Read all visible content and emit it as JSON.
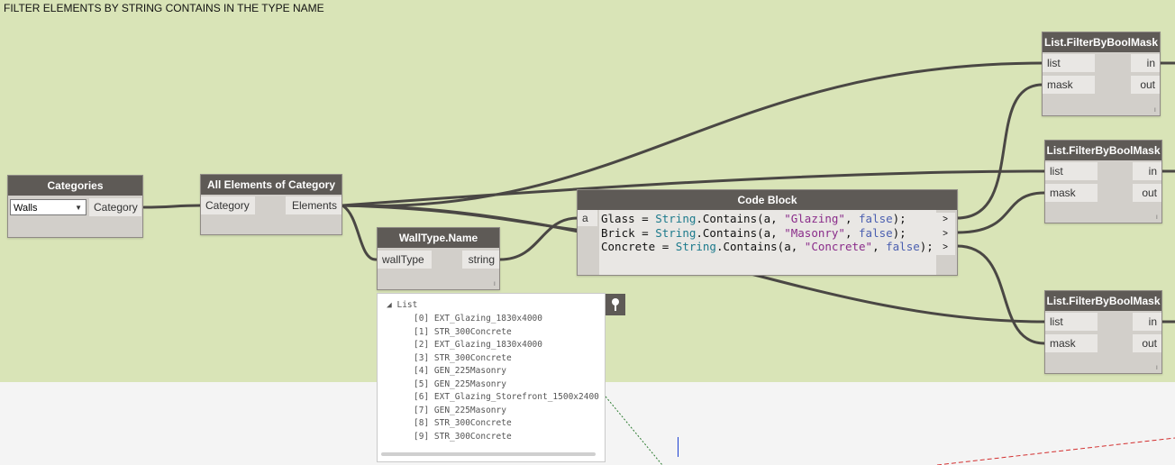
{
  "group": {
    "title": "FILTER ELEMENTS BY STRING CONTAINS IN THE TYPE NAME"
  },
  "nodes": {
    "categories": {
      "title": "Categories",
      "dropdown_value": "Walls",
      "output": "Category"
    },
    "all_elements": {
      "title": "All Elements of Category",
      "input": "Category",
      "output": "Elements"
    },
    "walltype_name": {
      "title": "WallType.Name",
      "input": "wallType",
      "output": "string"
    },
    "code_block": {
      "title": "Code Block",
      "input": "a",
      "lines": [
        {
          "var": "Glass",
          "search": "\"Glazing\""
        },
        {
          "var": "Brick",
          "search": "\"Masonry\""
        },
        {
          "var": "Concrete",
          "search": "\"Concrete\""
        }
      ],
      "call": "String",
      "method": ".Contains(a, ",
      "bool": "false",
      "output_symbol": ">"
    },
    "filter1": {
      "title": "List.FilterByBoolMask",
      "in_list": "list",
      "in_mask": "mask",
      "out_in": "in",
      "out_out": "out"
    },
    "filter2": {
      "title": "List.FilterByBoolMask",
      "in_list": "list",
      "in_mask": "mask",
      "out_in": "in",
      "out_out": "out"
    },
    "filter3": {
      "title": "List.FilterByBoolMask",
      "in_list": "list",
      "in_mask": "mask",
      "out_in": "in",
      "out_out": "out"
    }
  },
  "preview": {
    "root_label": "List",
    "items": [
      "[0] EXT_Glazing_1830x4000",
      "[1] STR_300Concrete",
      "[2] EXT_Glazing_1830x4000",
      "[3] STR_300Concrete",
      "[4] GEN_225Masonry",
      "[5] GEN_225Masonry",
      "[6] EXT_Glazing_Storefront_1500x2400",
      "[7] GEN_225Masonry",
      "[8] STR_300Concrete",
      "[9] STR_300Concrete"
    ]
  },
  "colors": {
    "canvas_group": "#d9e4b7",
    "node_header": "#5e5a56",
    "wire": "#4a4744"
  }
}
